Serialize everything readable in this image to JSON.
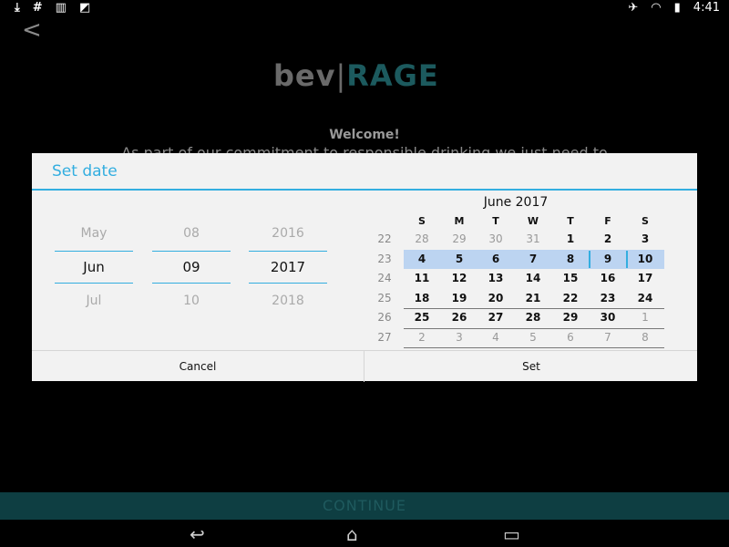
{
  "status_bar": {
    "icons_left": [
      "download-icon",
      "hash-icon",
      "barcode-icon",
      "image-icon"
    ],
    "icons_right": [
      "mute-icon",
      "wifi-icon",
      "battery-icon"
    ],
    "time": "4:41"
  },
  "app": {
    "logo": {
      "bev": "bev",
      "separator": "|",
      "rage": "RAGE"
    },
    "welcome_title": "Welcome!",
    "welcome_body": "As part of our commitment to responsible drinking we just need to",
    "continue_label": "CONTINUE"
  },
  "dialog": {
    "title": "Set date",
    "spinners": {
      "month": {
        "prev": "May",
        "selected": "Jun",
        "next": "Jul"
      },
      "day": {
        "prev": "08",
        "selected": "09",
        "next": "10"
      },
      "year": {
        "prev": "2016",
        "selected": "2017",
        "next": "2018"
      }
    },
    "calendar": {
      "title": "June 2017",
      "weekdays": [
        "S",
        "M",
        "T",
        "W",
        "T",
        "F",
        "S"
      ],
      "weeks": [
        {
          "week": "22",
          "days": [
            "28",
            "29",
            "30",
            "31",
            "1",
            "2",
            "3"
          ]
        },
        {
          "week": "23",
          "days": [
            "4",
            "5",
            "6",
            "7",
            "8",
            "9",
            "10"
          ]
        },
        {
          "week": "24",
          "days": [
            "11",
            "12",
            "13",
            "14",
            "15",
            "16",
            "17"
          ]
        },
        {
          "week": "25",
          "days": [
            "18",
            "19",
            "20",
            "21",
            "22",
            "23",
            "24"
          ]
        },
        {
          "week": "26",
          "days": [
            "25",
            "26",
            "27",
            "28",
            "29",
            "30",
            "1"
          ]
        },
        {
          "week": "27",
          "days": [
            "2",
            "3",
            "4",
            "5",
            "6",
            "7",
            "8"
          ]
        }
      ],
      "selected_day": "9",
      "colors": {
        "accent": "#33aee0",
        "highlight": "#bcd4f1"
      }
    },
    "buttons": {
      "cancel": "Cancel",
      "set": "Set"
    }
  },
  "nav": {
    "icons": [
      "back-icon",
      "home-icon",
      "recents-icon"
    ]
  }
}
